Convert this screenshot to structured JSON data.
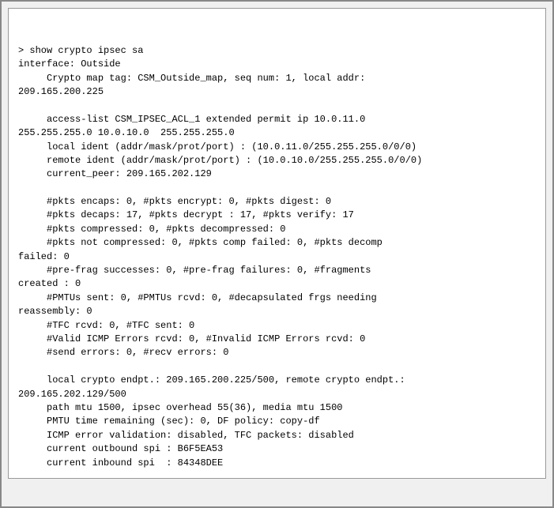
{
  "terminal": {
    "lines": [
      "> show crypto ipsec sa",
      "interface: Outside",
      "     Crypto map tag: CSM_Outside_map, seq num: 1, local addr:",
      "209.165.200.225",
      "",
      "     access-list CSM_IPSEC_ACL_1 extended permit ip 10.0.11.0",
      "255.255.255.0 10.0.10.0  255.255.255.0",
      "     local ident (addr/mask/prot/port) : (10.0.11.0/255.255.255.0/0/0)",
      "     remote ident (addr/mask/prot/port) : (10.0.10.0/255.255.255.0/0/0)",
      "     current_peer: 209.165.202.129",
      "",
      "     #pkts encaps: 0, #pkts encrypt: 0, #pkts digest: 0",
      "     #pkts decaps: 17, #pkts decrypt : 17, #pkts verify: 17",
      "     #pkts compressed: 0, #pkts decompressed: 0",
      "     #pkts not compressed: 0, #pkts comp failed: 0, #pkts decomp",
      "failed: 0",
      "     #pre-frag successes: 0, #pre-frag failures: 0, #fragments",
      "created : 0",
      "     #PMTUs sent: 0, #PMTUs rcvd: 0, #decapsulated frgs needing",
      "reassembly: 0",
      "     #TFC rcvd: 0, #TFC sent: 0",
      "     #Valid ICMP Errors rcvd: 0, #Invalid ICMP Errors rcvd: 0",
      "     #send errors: 0, #recv errors: 0",
      "",
      "     local crypto endpt.: 209.165.200.225/500, remote crypto endpt.:",
      "209.165.202.129/500",
      "     path mtu 1500, ipsec overhead 55(36), media mtu 1500",
      "     PMTU time remaining (sec): 0, DF policy: copy-df",
      "     ICMP error validation: disabled, TFC packets: disabled",
      "     current outbound spi : B6F5EA53",
      "     current inbound spi  : 84348DEE"
    ]
  }
}
